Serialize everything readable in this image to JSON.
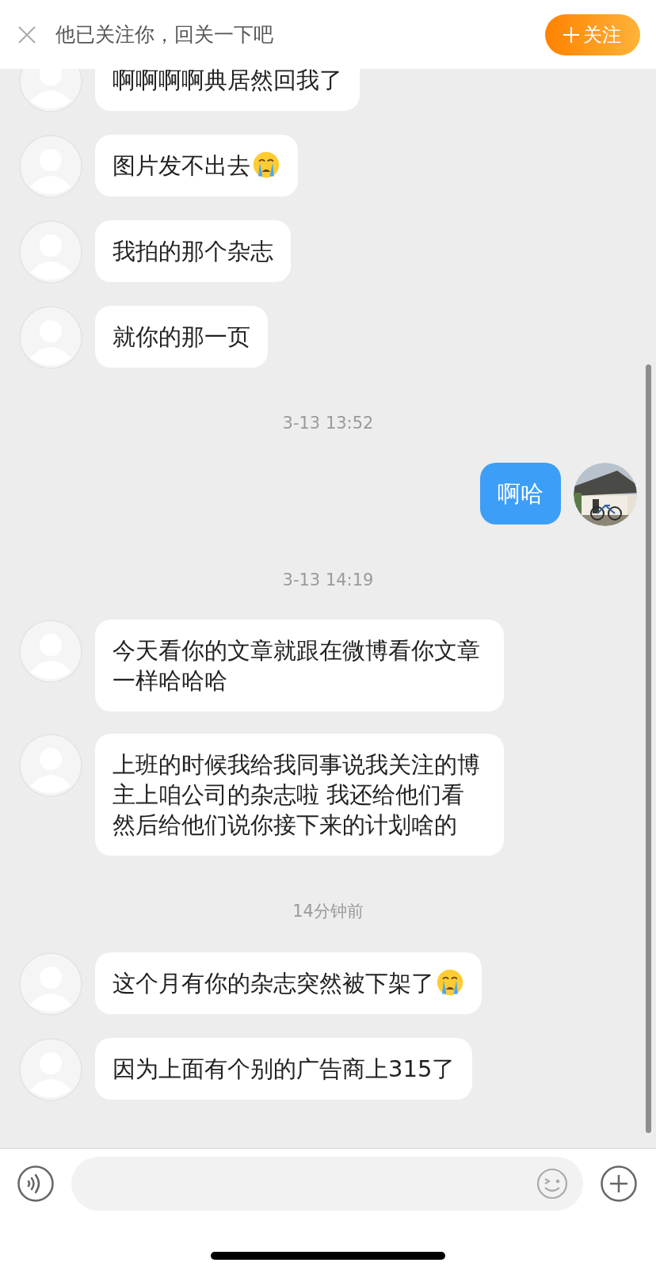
{
  "follow_bar": {
    "text": "他已关注你，回关一下吧",
    "button": "关注"
  },
  "messages": [
    {
      "kind": "incoming",
      "text": "啊啊啊啊典居然回我了"
    },
    {
      "kind": "incoming",
      "text": "图片发不出去",
      "emoji": true
    },
    {
      "kind": "incoming",
      "text": "我拍的那个杂志"
    },
    {
      "kind": "incoming",
      "text": "就你的那一页"
    },
    {
      "kind": "time",
      "text": "3-13 13:52"
    },
    {
      "kind": "outgoing",
      "text": "啊哈"
    },
    {
      "kind": "time",
      "text": "3-13 14:19"
    },
    {
      "kind": "incoming",
      "text": "今天看你的文章就跟在微博看你文章一样哈哈哈"
    },
    {
      "kind": "incoming",
      "text": "上班的时候我给我同事说我关注的博主上咱公司的杂志啦 我还给他们看然后给他们说你接下来的计划啥的"
    },
    {
      "kind": "time",
      "text": "14分钟前"
    },
    {
      "kind": "incoming",
      "text": "这个月有你的杂志突然被下架了",
      "emoji": true
    },
    {
      "kind": "incoming",
      "text": "因为上面有个别的广告商上315了"
    }
  ]
}
